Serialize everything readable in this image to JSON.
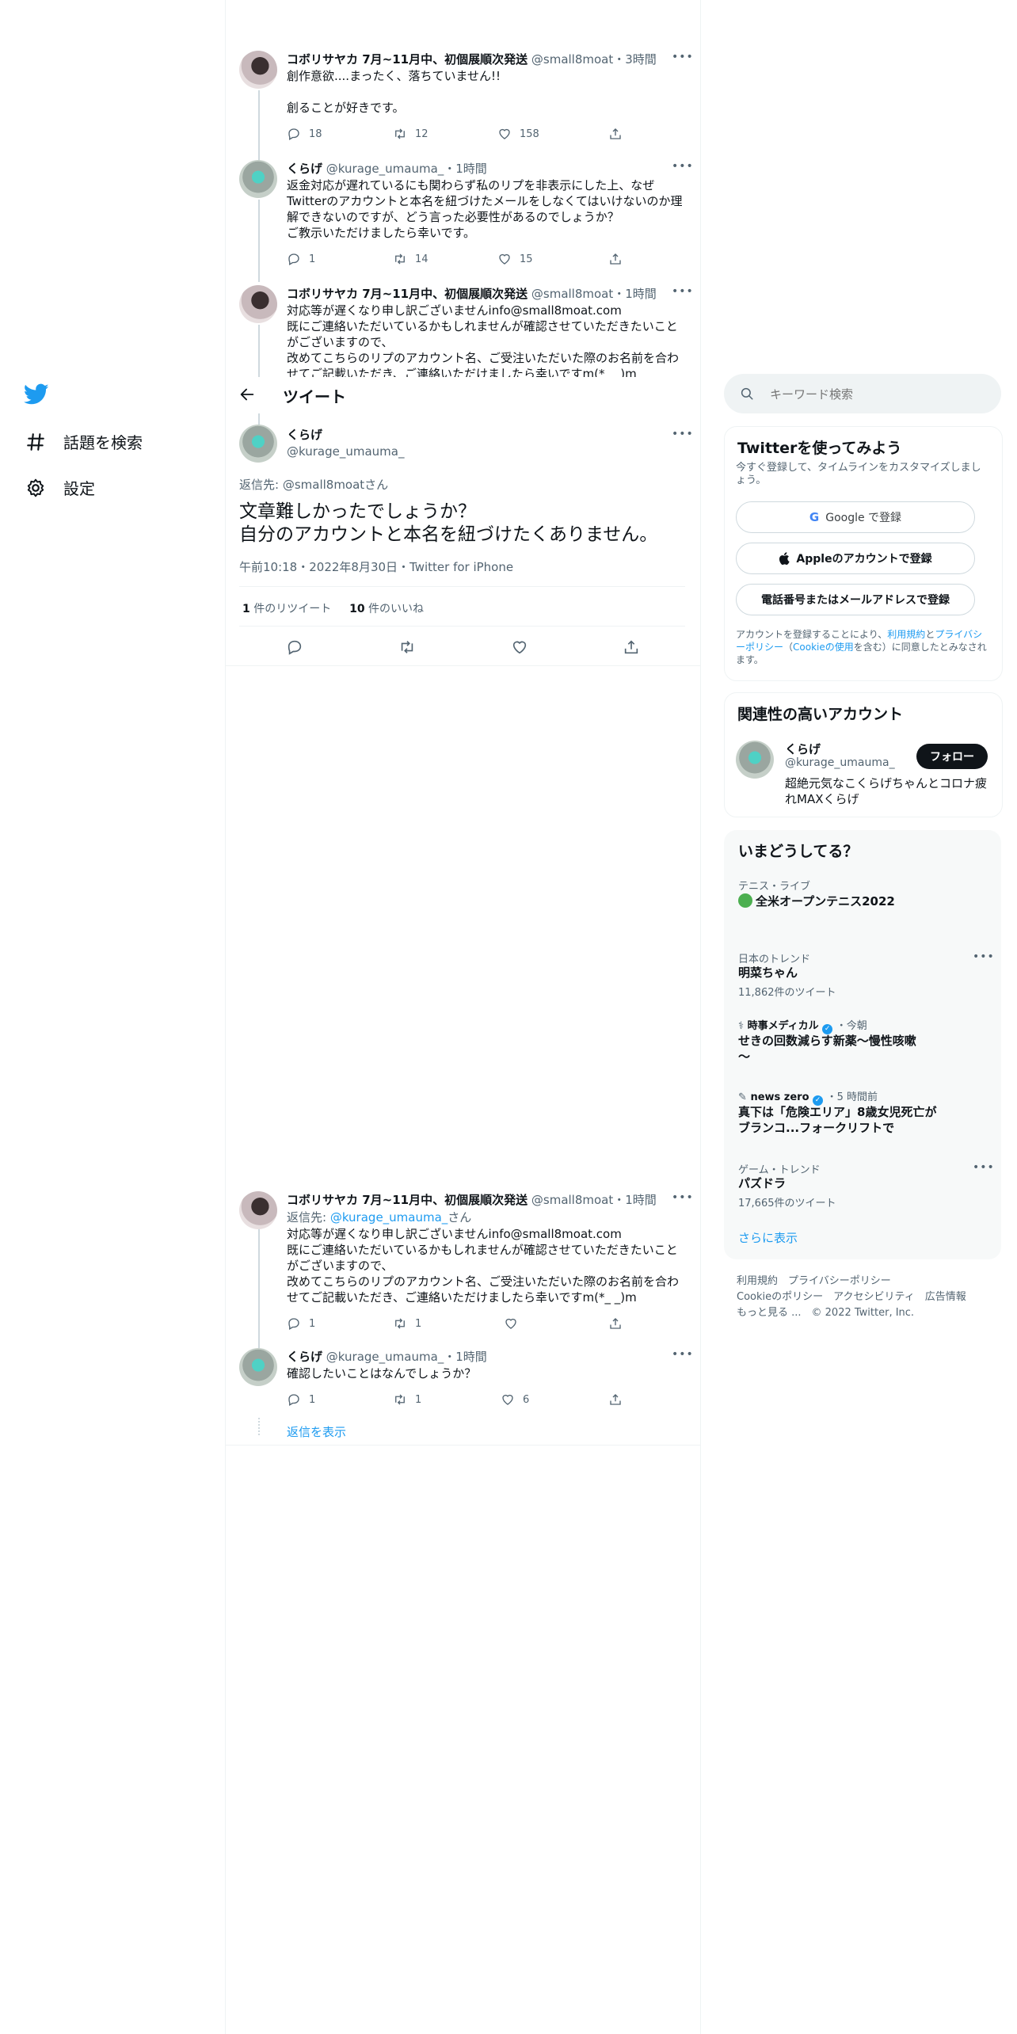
{
  "sidebar": {
    "items": [
      {
        "label": "話題を検索",
        "icon": "hashtag-icon"
      },
      {
        "label": "設定",
        "icon": "gear-icon"
      }
    ]
  },
  "header": {
    "title": "ツイート"
  },
  "tweets_above": [
    {
      "name": "コボリサヤカ 7月~11月中、初個展順次発送",
      "handle": "@small8moat",
      "time": "・3時間",
      "text": "創作意欲....まったく、落ちていません!!\n\n創ることが好きです。",
      "replies": "18",
      "retweets": "12",
      "likes": "158"
    },
    {
      "name": "くらげ",
      "handle": "@kurage_umauma_",
      "time": "・1時間",
      "text": "返金対応が遅れているにも関わらず私のリプを非表示にした上、なぜ\nTwitterのアカウントと本名を紐づけたメールをしなくてはいけないのか理\n解できないのですが、どう言った必要性があるのでしょうか？\nご教示いただけましたら幸いです。",
      "replies": "1",
      "retweets": "14",
      "likes": "15"
    },
    {
      "name": "コボリサヤカ 7月~11月中、初個展順次発送",
      "handle": "@small8moat",
      "time": "・1時間",
      "text": "対応等が遅くなり申し訳ございませんinfo@small8moat.com\n既にご連絡いただいているかもしれませんが確認させていただきたいこと\nがございますので、\n改めてこちらのリプのアカウント名、ご受注いただいた際のお名前を合わ\nせてご記載いただき、ご連絡いただけましたら幸いですm(*_ _)m"
    }
  ],
  "main_tweet": {
    "name": "くらげ",
    "handle": "@kurage_umauma_",
    "reply_to_label": "返信先: @small8moatさん",
    "text": "文章難しかったでしょうか？\n自分のアカウントと本名を紐づけたくありません。",
    "timestamp": "午前10:18・2022年8月30日・Twitter for iPhone",
    "retweet_count": "1",
    "retweet_label": "件のリツイート",
    "like_count": "10",
    "like_label": "件のいいね"
  },
  "replies": [
    {
      "name": "コボリサヤカ 7月~11月中、初個展順次発送",
      "handle": "@small8moat",
      "time": "・1時間",
      "reply_prefix": "返信先: ",
      "reply_handle": "@kurage_umauma_",
      "reply_suffix": "さん",
      "text": "対応等が遅くなり申し訳ございませんinfo@small8moat.com\n既にご連絡いただいているかもしれませんが確認させていただきたいこと\nがございますので、\n改めてこちらのリプのアカウント名、ご受注いただいた際のお名前を合わ\nせてご記載いただき、ご連絡いただけましたら幸いですm(*_ _)m",
      "replies": "1",
      "retweets": "1"
    },
    {
      "name": "くらげ",
      "handle": "@kurage_umauma_",
      "time": "・1時間",
      "text": "確認したいことはなんでしょうか？",
      "replies": "1",
      "retweets": "1",
      "likes": "6"
    }
  ],
  "show_replies": "返信を表示",
  "search": {
    "placeholder": "キーワード検索"
  },
  "signup": {
    "title": "Twitterを使ってみよう",
    "subtitle": "今すぐ登録して、タイムラインをカスタマイズしましょう。",
    "google_label": "Google で登録",
    "apple_label": "Appleのアカウントで登録",
    "phone_label": "電話番号またはメールアドレスで登録",
    "legal_prefix": "アカウントを登録することにより、",
    "legal_terms": "利用規約",
    "legal_and": "と",
    "legal_privacy": "プライバシーポリシー",
    "legal_open": "（",
    "legal_cookie": "Cookieの使用",
    "legal_suffix": "を含む）に同意したとみなされます。"
  },
  "related": {
    "title": "関連性の高いアカウント",
    "name": "くらげ",
    "handle": "@kurage_umauma_",
    "follow_label": "フォロー",
    "bio": "超絶元気なこくらげちゃんとコロナ疲れMAXくらげ"
  },
  "trends": {
    "title": "いまどうしてる？",
    "items": [
      {
        "category": "テニス・ライブ",
        "title": "全米オープンテニス2022"
      },
      {
        "category": "日本のトレンド",
        "title": "明菜ちゃん",
        "count": "11,862件のツイート"
      },
      {
        "source": "時事メディカル",
        "time": "・今朝",
        "title": "せきの回数減らす新薬～慢性咳嗽\n～"
      },
      {
        "source": "news zero",
        "time": "・5 時間前",
        "title": "真下は「危険エリア」8歳女児死亡が\nブランコ...フォークリフトで"
      },
      {
        "category": "ゲーム・トレンド",
        "title": "パズドラ",
        "count": "17,665件のツイート"
      }
    ],
    "show_more": "さらに表示"
  },
  "footer": {
    "line1": "利用規約　プライバシーポリシー",
    "line2": "Cookieのポリシー　アクセシビリティ　広告情報",
    "line3": "もっと見る ...　© 2022 Twitter, Inc."
  },
  "colors": {
    "accent": "#1d9bf0",
    "text": "#0f1419",
    "muted": "#536471",
    "panel": "#f7f9f9"
  }
}
